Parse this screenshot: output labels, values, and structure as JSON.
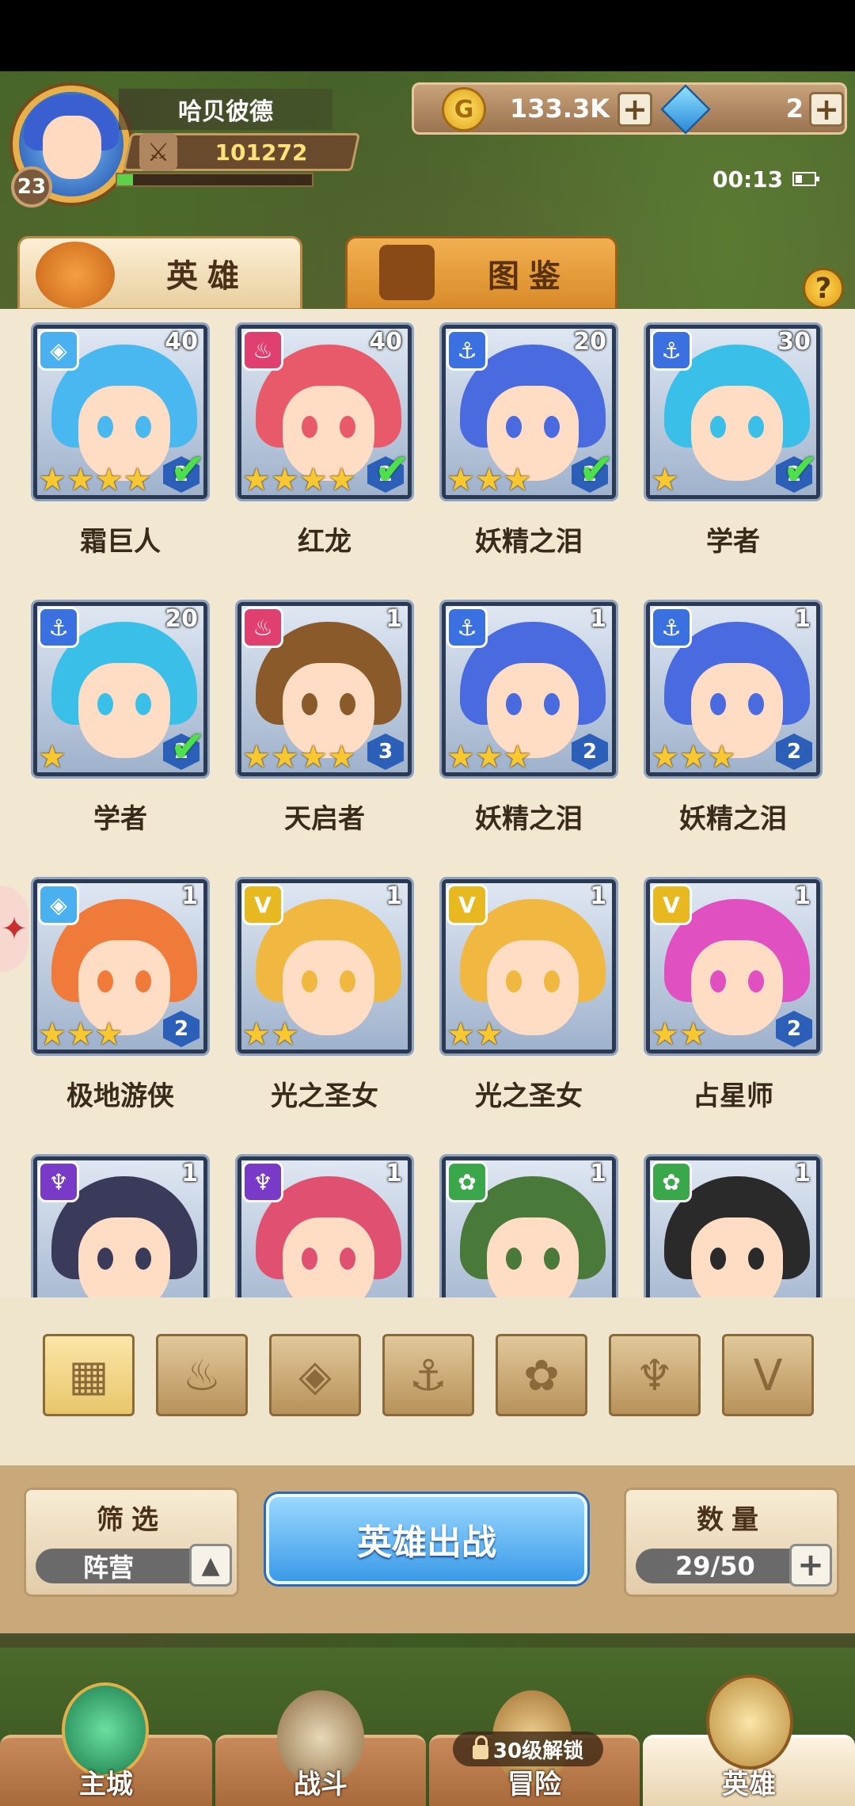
{
  "player": {
    "name": "哈贝彼德",
    "level": "23",
    "power": "101272",
    "xp_fraction": 0.08
  },
  "currency": {
    "gold": "133.3K",
    "gems": "2"
  },
  "status": {
    "time": "00:13"
  },
  "tabs": [
    {
      "label": "英雄",
      "active": true
    },
    {
      "label": "图鉴",
      "active": false
    }
  ],
  "help": "?",
  "heroes": [
    {
      "name": "霜巨人",
      "level": "40",
      "stars": 4,
      "grade": "2",
      "deployed": true,
      "faction": "ice",
      "color": "#4ab8f0"
    },
    {
      "name": "红龙",
      "level": "40",
      "stars": 4,
      "grade": "2",
      "deployed": true,
      "faction": "fire",
      "color": "#e85a6a"
    },
    {
      "name": "妖精之泪",
      "level": "20",
      "stars": 3,
      "grade": "2",
      "deployed": true,
      "faction": "water",
      "color": "#4a6ae0"
    },
    {
      "name": "学者",
      "level": "30",
      "stars": 1,
      "grade": "2",
      "deployed": true,
      "faction": "water",
      "color": "#3ac0e8"
    },
    {
      "name": "学者",
      "level": "20",
      "stars": 1,
      "grade": "2",
      "deployed": true,
      "faction": "water",
      "color": "#3ac0e8"
    },
    {
      "name": "天启者",
      "level": "1",
      "stars": 4,
      "grade": "3",
      "deployed": false,
      "faction": "fire",
      "color": "#8a5a2a"
    },
    {
      "name": "妖精之泪",
      "level": "1",
      "stars": 3,
      "grade": "2",
      "deployed": false,
      "faction": "water",
      "color": "#4a6ae0"
    },
    {
      "name": "妖精之泪",
      "level": "1",
      "stars": 3,
      "grade": "2",
      "deployed": false,
      "faction": "water",
      "color": "#4a6ae0"
    },
    {
      "name": "极地游侠",
      "level": "1",
      "stars": 3,
      "grade": "2",
      "deployed": false,
      "faction": "ice",
      "color": "#f07a3a"
    },
    {
      "name": "光之圣女",
      "level": "1",
      "stars": 2,
      "grade": "",
      "deployed": false,
      "faction": "light",
      "color": "#f0b840"
    },
    {
      "name": "光之圣女",
      "level": "1",
      "stars": 2,
      "grade": "",
      "deployed": false,
      "faction": "light",
      "color": "#f0b840"
    },
    {
      "name": "占星师",
      "level": "1",
      "stars": 2,
      "grade": "2",
      "deployed": false,
      "faction": "light",
      "color": "#e050c0"
    },
    {
      "name": "",
      "level": "1",
      "stars": 0,
      "grade": "",
      "deployed": false,
      "faction": "dark",
      "color": "#3a3a5a"
    },
    {
      "name": "",
      "level": "1",
      "stars": 0,
      "grade": "",
      "deployed": false,
      "faction": "dark",
      "color": "#e05070"
    },
    {
      "name": "",
      "level": "1",
      "stars": 0,
      "grade": "",
      "deployed": false,
      "faction": "nature",
      "color": "#4a7a3a"
    },
    {
      "name": "",
      "level": "1",
      "stars": 0,
      "grade": "",
      "deployed": false,
      "faction": "nature",
      "color": "#2a2a2a"
    }
  ],
  "faction_colors": {
    "ice": "#4ab0f0",
    "fire": "#e04070",
    "water": "#3a70e0",
    "light": "#e8b820",
    "dark": "#7a3ac8",
    "nature": "#3aa84a"
  },
  "faction_glyphs": {
    "ice": "◈",
    "fire": "♨",
    "water": "⚓",
    "light": "V",
    "dark": "♆",
    "nature": "✿"
  },
  "filters": [
    {
      "icon": "grid-icon",
      "glyph": "▦",
      "active": true
    },
    {
      "icon": "flame-icon",
      "glyph": "♨",
      "active": false
    },
    {
      "icon": "diamond-icon",
      "glyph": "◈",
      "active": false
    },
    {
      "icon": "anchor-icon",
      "glyph": "⚓",
      "active": false
    },
    {
      "icon": "beast-icon",
      "glyph": "✿",
      "active": false
    },
    {
      "icon": "demon-icon",
      "glyph": "♆",
      "active": false
    },
    {
      "icon": "wing-icon",
      "glyph": "V",
      "active": false
    }
  ],
  "controls": {
    "filter_title": "筛选",
    "filter_value": "阵营",
    "deploy_label": "英雄出战",
    "count_title": "数量",
    "count_value": "29/50"
  },
  "nav": [
    {
      "label": "主城",
      "active": false
    },
    {
      "label": "战斗",
      "active": false
    },
    {
      "label": "冒险",
      "active": false,
      "lock_text": "30级解锁"
    },
    {
      "label": "英雄",
      "active": true
    }
  ]
}
